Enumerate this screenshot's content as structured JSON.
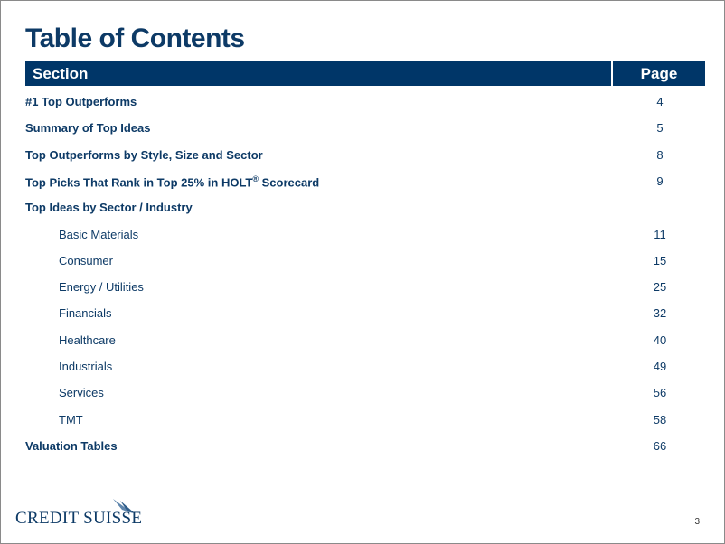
{
  "title": "Table of Contents",
  "header": {
    "section": "Section",
    "page": "Page"
  },
  "rows": [
    {
      "label": "#1 Top Outperforms",
      "page": "4",
      "level": "main"
    },
    {
      "label": "Summary of Top Ideas",
      "page": "5",
      "level": "main"
    },
    {
      "label": "Top Outperforms by Style, Size and Sector",
      "page": "8",
      "level": "main"
    },
    {
      "label": "Top Picks That Rank in Top 25% in HOLT",
      "sup": "®",
      "suffix": " Scorecard",
      "page": "9",
      "level": "main"
    },
    {
      "label": "Top Ideas by Sector / Industry",
      "page": "",
      "level": "main"
    },
    {
      "label": "Basic Materials",
      "page": "11",
      "level": "sub"
    },
    {
      "label": "Consumer",
      "page": "15",
      "level": "sub"
    },
    {
      "label": "Energy / Utilities",
      "page": "25",
      "level": "sub"
    },
    {
      "label": "Financials",
      "page": "32",
      "level": "sub"
    },
    {
      "label": "Healthcare",
      "page": "40",
      "level": "sub"
    },
    {
      "label": "Industrials",
      "page": "49",
      "level": "sub"
    },
    {
      "label": "Services",
      "page": "56",
      "level": "sub"
    },
    {
      "label": "TMT",
      "page": "58",
      "level": "sub"
    },
    {
      "label": "Valuation Tables",
      "page": "66",
      "level": "main"
    }
  ],
  "footer": {
    "logo_text": "CREDIT SUISSE",
    "page_number": "3"
  },
  "colors": {
    "brand": "#003668",
    "text": "#0d3a66"
  }
}
